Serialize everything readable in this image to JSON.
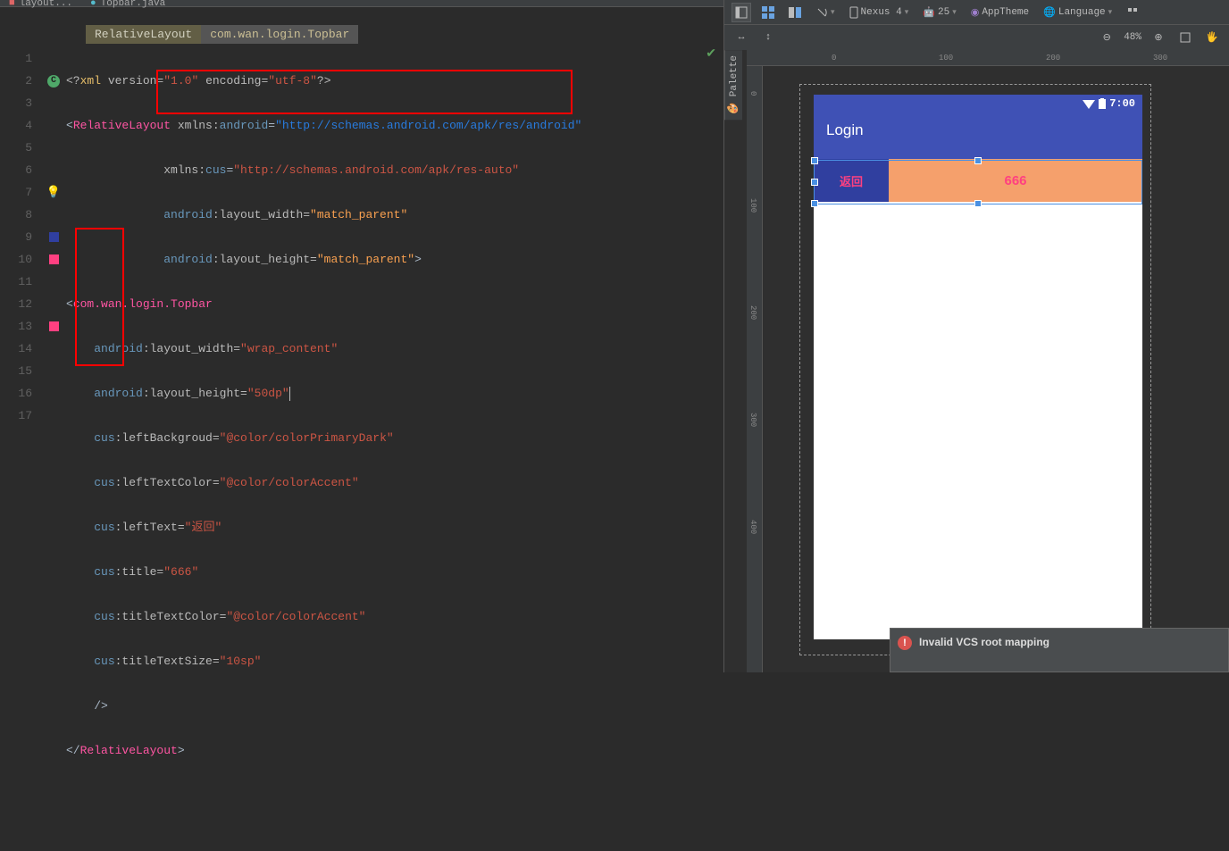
{
  "tabs": {
    "left": "layout...",
    "right": "Topbar.java"
  },
  "breadcrumb": {
    "a": "RelativeLayout",
    "b": "com.wan.login.Topbar"
  },
  "gutter": [
    "1",
    "2",
    "3",
    "4",
    "5",
    "6",
    "7",
    "8",
    "9",
    "10",
    "11",
    "12",
    "13",
    "14",
    "15",
    "16",
    "17"
  ],
  "code": {
    "l1": {
      "open": "<?",
      "x": "xml",
      "ver_attr": "version=",
      "ver_val": "\"1.0\"",
      "enc_attr": "encoding=",
      "enc_val": "\"utf-8\"",
      "close": "?>"
    },
    "l2": {
      "open": "<",
      "tag": "RelativeLayout",
      "xmlns": "xmlns:",
      "ns": "android",
      "eq": "=",
      "val": "\"http://schemas.android.com/apk/res/android\""
    },
    "l3": {
      "xmlns": "xmlns:",
      "ns": "cus",
      "eq": "=",
      "val": "\"http://schemas.android.com/apk/res-auto\""
    },
    "l4": {
      "ns": "android",
      "attr": ":layout_width=",
      "val": "\"match_parent\""
    },
    "l5": {
      "ns": "android",
      "attr": ":layout_height=",
      "val": "\"match_parent\"",
      "close": ">"
    },
    "l6": {
      "open": "<",
      "tag": "com.wan.login.Topbar"
    },
    "l7": {
      "ns": "android",
      "attr": ":layout_width=",
      "val": "\"wrap_content\""
    },
    "l8": {
      "ns": "android",
      "attr": ":layout_height=",
      "val": "\"50dp\""
    },
    "l9": {
      "ns": "cus",
      "attr": ":leftBackgroud=",
      "val": "\"@color/colorPrimaryDark\""
    },
    "l10": {
      "ns": "cus",
      "attr": ":leftTextColor=",
      "val": "\"@color/colorAccent\""
    },
    "l11": {
      "ns": "cus",
      "attr": ":leftText=",
      "val": "\"返回\""
    },
    "l12": {
      "ns": "cus",
      "attr": ":title=",
      "val": "\"666\""
    },
    "l13": {
      "ns": "cus",
      "attr": ":titleTextColor=",
      "val": "\"@color/colorAccent\""
    },
    "l14": {
      "ns": "cus",
      "attr": ":titleTextSize=",
      "val": "\"10sp\""
    },
    "l15": {
      "close": "/>"
    },
    "l16": {
      "open": "</",
      "tag": "RelativeLayout",
      "close": ">"
    }
  },
  "toolbar": {
    "device": "Nexus 4",
    "api": "25",
    "theme": "AppTheme",
    "language": "Language",
    "zoom": "48%"
  },
  "ruler_h": {
    "t0": "0",
    "t1": "100",
    "t2": "200",
    "t3": "300"
  },
  "ruler_v": {
    "t0": "0",
    "t1": "100",
    "t2": "200",
    "t3": "300",
    "t4": "400"
  },
  "preview": {
    "status_time": "7:00",
    "appbar": "Login",
    "topbar_left": "返回",
    "topbar_title": "666"
  },
  "palette": "Palette",
  "notif": "Invalid VCS root mapping"
}
